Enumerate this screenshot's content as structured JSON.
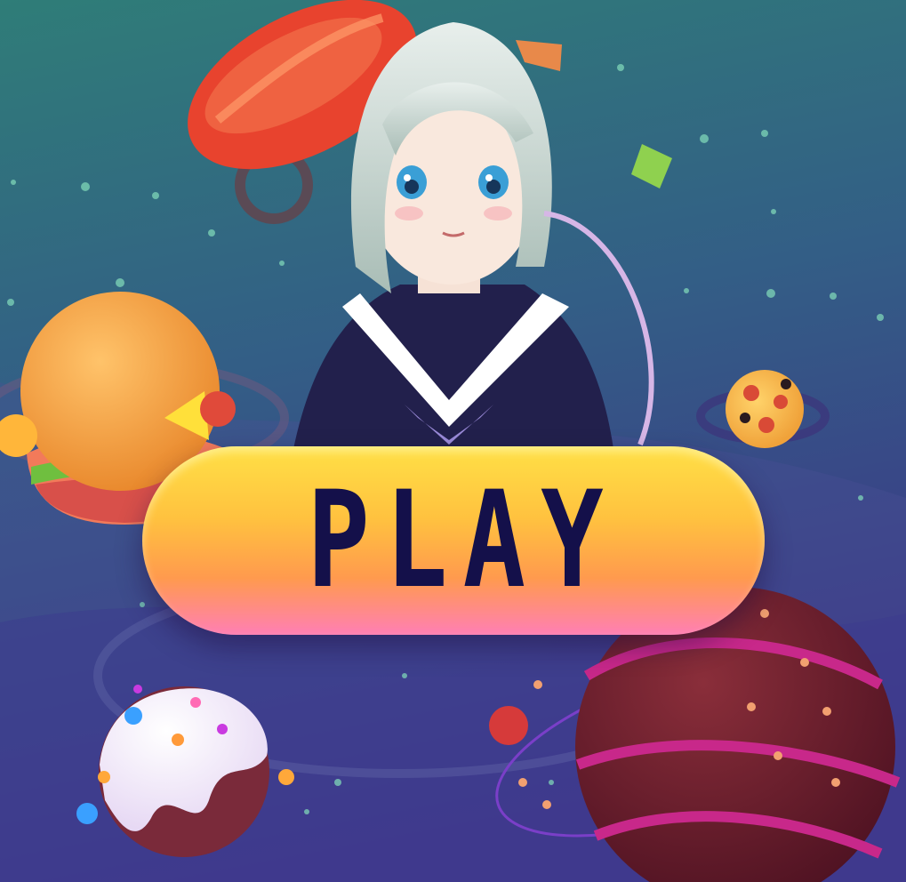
{
  "screen": "start-menu",
  "play_button": {
    "label": "PLAY"
  },
  "colors": {
    "background_top": "#2e7a76",
    "background_bottom": "#3c2f86",
    "button_top": "#ffe046",
    "button_bottom": "#ff7fb4",
    "button_text": "#14104a"
  },
  "decorations": [
    "sausage-planet",
    "burger-planet",
    "pizza-planet",
    "frosted-donut-planet",
    "chocolate-planet",
    "anime-girl-character"
  ]
}
